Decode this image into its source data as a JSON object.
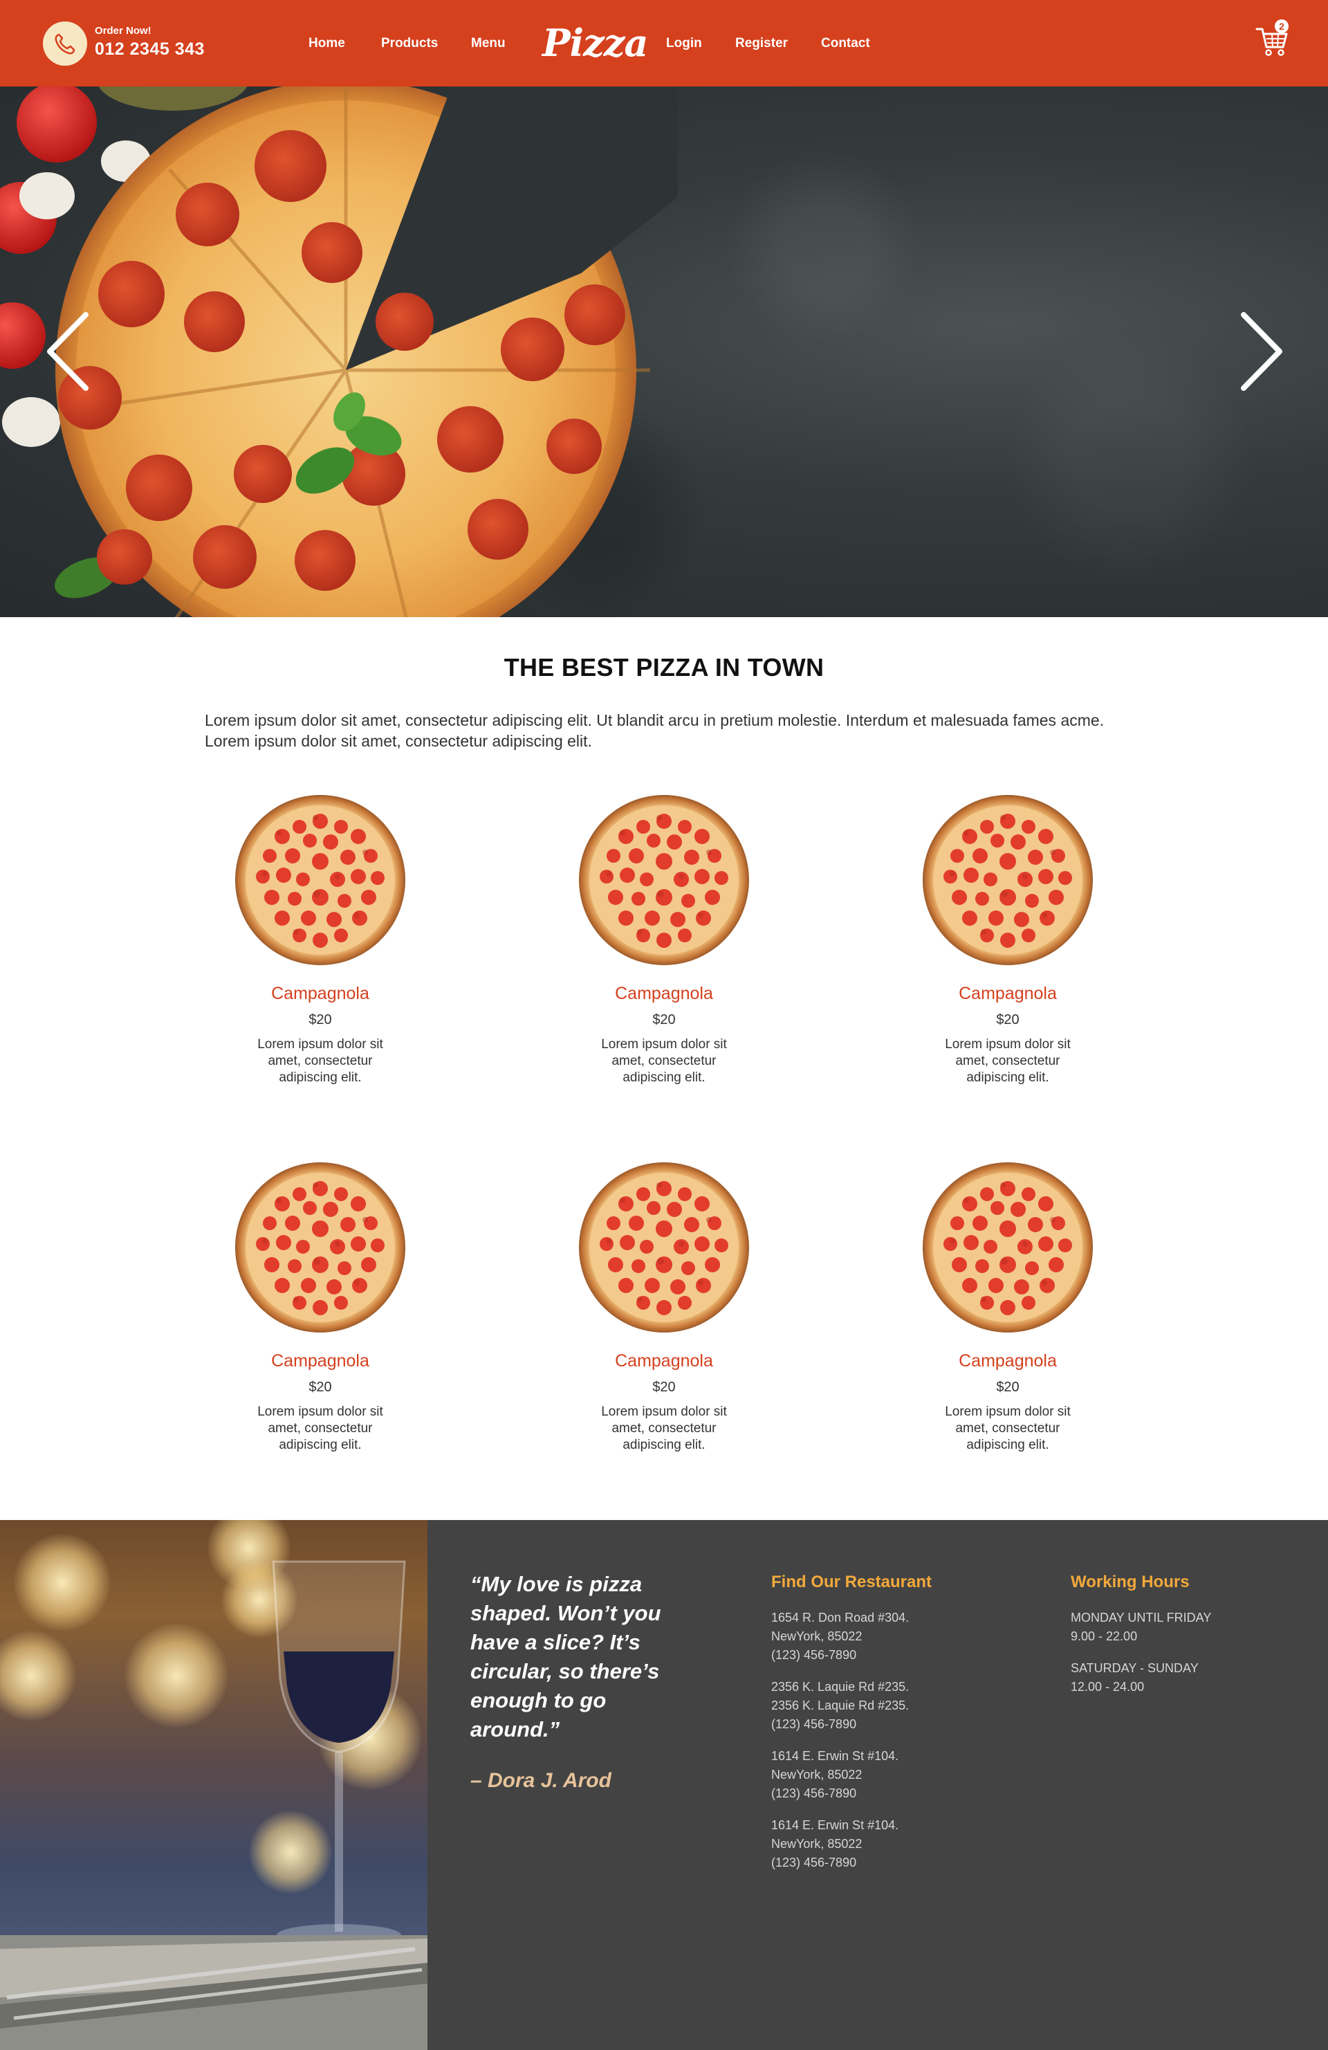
{
  "header": {
    "order_label": "Order Now!",
    "phone": "012 2345 343",
    "logo": "Pizza",
    "cart_count": "2",
    "accent_color": "#d5401d",
    "nav": {
      "home": "Home",
      "products": "Products",
      "menu": "Menu",
      "login": "Login",
      "register": "Register",
      "contact": "Contact"
    },
    "icons": [
      "phone-icon",
      "cart-icon"
    ]
  },
  "hero": {
    "prev_icon": "chevron-left-icon",
    "next_icon": "chevron-right-icon"
  },
  "intro": {
    "title": "THE BEST PIZZA IN TOWN",
    "text": "Lorem ipsum dolor sit amet, consectetur adipiscing elit. Ut blandit arcu in pretium molestie. Interdum et malesuada fames acme. Lorem ipsum dolor sit amet, consectetur adipiscing elit."
  },
  "products": [
    {
      "name": "Campagnola",
      "price": "$20",
      "desc": "Lorem ipsum dolor sit amet, consectetur adipiscing elit."
    },
    {
      "name": "Campagnola",
      "price": "$20",
      "desc": "Lorem ipsum dolor sit amet, consectetur adipiscing elit."
    },
    {
      "name": "Campagnola",
      "price": "$20",
      "desc": "Lorem ipsum dolor sit amet, consectetur adipiscing elit."
    },
    {
      "name": "Campagnola",
      "price": "$20",
      "desc": "Lorem ipsum dolor sit amet, consectetur adipiscing elit."
    },
    {
      "name": "Campagnola",
      "price": "$20",
      "desc": "Lorem ipsum dolor sit amet, consectetur adipiscing elit."
    },
    {
      "name": "Campagnola",
      "price": "$20",
      "desc": "Lorem ipsum dolor sit amet, consectetur adipiscing elit."
    }
  ],
  "footer": {
    "quote": "“My love is pizza shaped. Won’t you have a slice? It’s circular, so there’s enough to go around.”",
    "author": "– Dora J. Arod",
    "find_title": "Find Our Restaurant",
    "addresses": [
      {
        "line1": "1654 R. Don Road #304.",
        "line2": "NewYork, 85022",
        "phone": "(123) 456-7890"
      },
      {
        "line1": "2356 K. Laquie Rd #235.",
        "line2": "2356 K. Laquie Rd #235.",
        "phone": "(123) 456-7890"
      },
      {
        "line1": "1614 E. Erwin St #104.",
        "line2": "NewYork, 85022",
        "phone": "(123) 456-7890"
      },
      {
        "line1": "1614 E. Erwin St #104.",
        "line2": "NewYork, 85022",
        "phone": "(123) 456-7890"
      }
    ],
    "hours_title": "Working Hours",
    "hours": [
      {
        "days": "MONDAY UNTIL FRIDAY",
        "time": "9.00 - 22.00"
      },
      {
        "days": "SATURDAY - SUNDAY",
        "time": "12.00 - 24.00"
      }
    ],
    "heading_color": "#f2a93b"
  }
}
